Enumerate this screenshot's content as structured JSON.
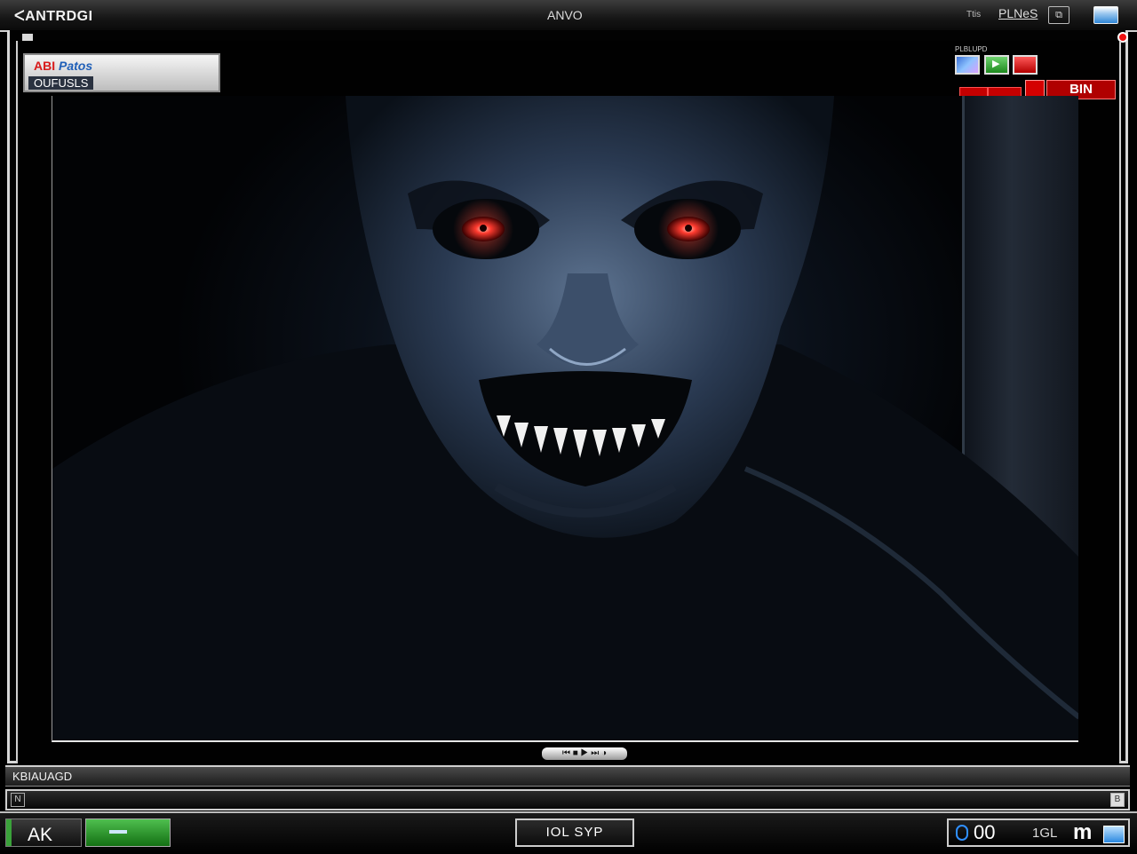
{
  "window": {
    "title_left": "ᐸANTRDGI",
    "title_center": "ANVO",
    "title_small": "Ttis",
    "title_right": "PLNeS",
    "maximize_glyph": "⧉"
  },
  "overlay_panel": {
    "line1_red": "ABI",
    "line1_blue": "Patos",
    "line2": "OUFUSLS"
  },
  "top_right": {
    "label": "PLBLUPD",
    "icons": [
      "image-icon",
      "play-icon",
      "record-icon"
    ],
    "red_text": "BIN"
  },
  "media_controls_label": "⏮ ■ ▶ ⏭ ◑",
  "status": {
    "text": "KBIAUAGD"
  },
  "inputbar": {
    "left_glyph": "N",
    "right_glyph": "B"
  },
  "taskbar": {
    "left_label": "AK",
    "center_label": "IOL SYP",
    "right_num": "00",
    "right_small": "1GL",
    "right_m": "m"
  },
  "colors": {
    "accent_red": "#d40000",
    "accent_green": "#2e9e2e",
    "accent_blue": "#2f86d6",
    "creature_eye": "#ff3b2f"
  },
  "scene_description_icon": "creature-image"
}
